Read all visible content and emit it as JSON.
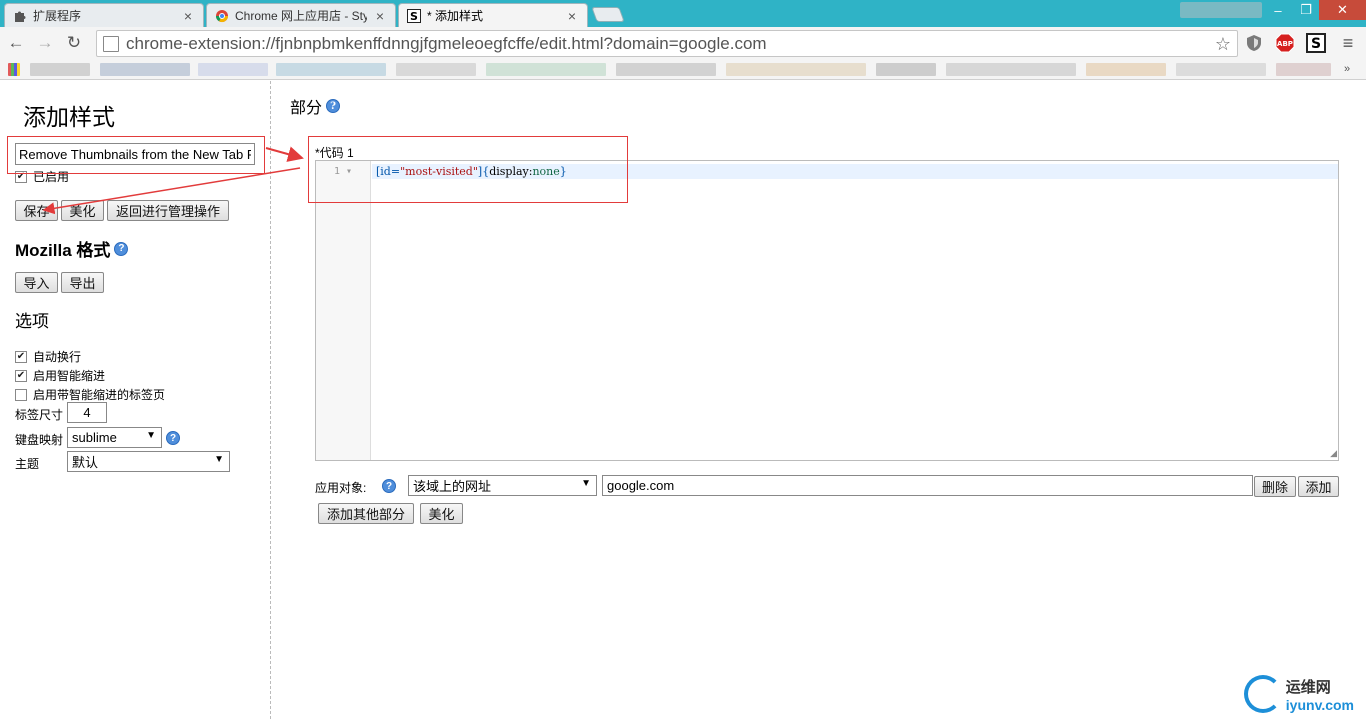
{
  "tabs": [
    {
      "title": "扩展程序",
      "icon": "puzzle-icon"
    },
    {
      "title": "Chrome 网上应用店 - Sty",
      "icon": "chrome-store-icon"
    },
    {
      "title": "* 添加样式",
      "icon": "stylish-icon"
    }
  ],
  "window_controls": {
    "minimize": "–",
    "restore": "❐",
    "close": "✕"
  },
  "toolbar": {
    "back": "←",
    "forward": "→",
    "reload": "↻",
    "url": "chrome-extension://fjnbnpbmkenffdnngjfgmeleoegfcffe/edit.html?domain=google.com",
    "star": "☆",
    "abp": "ABP",
    "stylish": "S",
    "menu": "≡"
  },
  "sidebar": {
    "title": "添加样式",
    "style_name_value": "Remove Thumbnails from the New Tab F",
    "enabled_label": "已启用",
    "enabled_checked": true,
    "save_label": "保存",
    "beautify_label": "美化",
    "back_label": "返回进行管理操作",
    "mozilla_heading": "Mozilla 格式",
    "import_label": "导入",
    "export_label": "导出",
    "options_heading": "选项",
    "options": [
      {
        "label": "自动换行",
        "checked": true
      },
      {
        "label": "启用智能缩进",
        "checked": true
      },
      {
        "label": "启用带智能缩进的标签页",
        "checked": false
      }
    ],
    "tab_size_label": "标签尺寸",
    "tab_size_value": "4",
    "keymap_label": "键盘映射",
    "keymap_value": "sublime",
    "theme_label": "主题",
    "theme_value": "默认"
  },
  "main": {
    "section_title": "部分",
    "code_label": "*代码 1",
    "line_number": "1",
    "code": {
      "sel_open": "[id=",
      "str": "\"most-visited\"",
      "sel_close": "]{",
      "prop": "display",
      "colon": ":",
      "val": "none",
      "close": "}"
    },
    "applies_label": "应用对象:",
    "applies_type": "该域上的网址",
    "applies_value": "google.com",
    "delete_label": "删除",
    "add_label": "添加",
    "add_section_label": "添加其他部分",
    "beautify_label": "美化"
  },
  "watermark": {
    "name": "运维网",
    "domain": "iyunv.com"
  },
  "colors": {
    "tabstrip": "#2fb3c6",
    "annotation": "#e23b3b",
    "help": "#4f8edb"
  }
}
